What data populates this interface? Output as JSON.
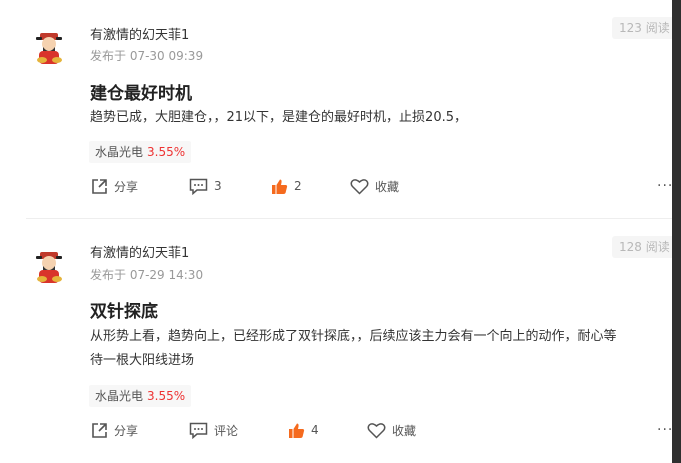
{
  "posts": [
    {
      "author": "有激情的幻天菲1",
      "date": "发布于 07-30 09:39",
      "views": "123 阅读",
      "title": "建仓最好时机",
      "body_line1": "趋势已成，大胆建仓，，21以下，是建仓的最好时机，止损20.5，",
      "body_line2": "",
      "stock_name": "水晶光电",
      "stock_change": "3.55%",
      "share_label": "分享",
      "comment_label": "3",
      "like_count": "2",
      "fav_label": "收藏",
      "more": "···"
    },
    {
      "author": "有激情的幻天菲1",
      "date": "发布于 07-29 14:30",
      "views": "128 阅读",
      "title": "双针探底",
      "body_line1": "从形势上看，趋势向上，已经形成了双针探底，，后续应该主力会有一个向上的动作，耐心等",
      "body_line2": "待一根大阳线进场",
      "stock_name": "水晶光电",
      "stock_change": "3.55%",
      "share_label": "分享",
      "comment_label": "评论",
      "like_count": "4",
      "fav_label": "收藏",
      "more": "···"
    }
  ],
  "colors": {
    "accent_like": "#f56a1e",
    "stock_up": "#e33333"
  }
}
